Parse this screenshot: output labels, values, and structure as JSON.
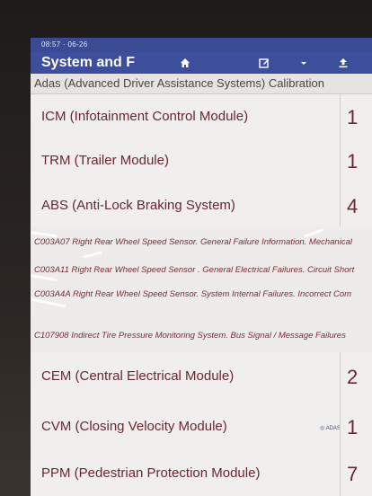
{
  "status_bar": {
    "time": "08:57 · 06-26"
  },
  "header": {
    "title": "System and F"
  },
  "breadcrumb": "Adas (Advanced Driver Assistance Systems) Calibration",
  "modules": [
    {
      "label": "ICM (Infotainment Control Module)",
      "count": "1"
    },
    {
      "label": "TRM (Trailer Module)",
      "count": "1"
    },
    {
      "label": "ABS (Anti-Lock Braking System)",
      "count": "4"
    },
    {
      "label": "CEM (Central Electrical Module)",
      "count": "2"
    },
    {
      "label": "CVM (Closing Velocity Module)",
      "count": "1",
      "badge": "ADAS"
    },
    {
      "label": "PPM (Pedestrian Protection Module)",
      "count": "7"
    }
  ],
  "abs_codes": [
    "C003A07 Right Rear Wheel Speed Sensor. General Failure Information. Mechanical",
    "C003A11 Right Rear Wheel Speed Sensor . General Electrical Failures. Circuit Short",
    "C003A4A Right Rear Wheel Speed Sensor. System Internal Failures. Incorrect Com",
    "C107908 Indirect Tire Pressure Monitoring System. Bus Signal / Message Failures"
  ],
  "colors": {
    "header_bg": "#3c4e9c",
    "text": "#6b2630",
    "row_bg": "#f1efee"
  },
  "icons": [
    "home-icon",
    "edit-icon",
    "dropdown-icon",
    "upload-icon",
    "adas-icon"
  ]
}
